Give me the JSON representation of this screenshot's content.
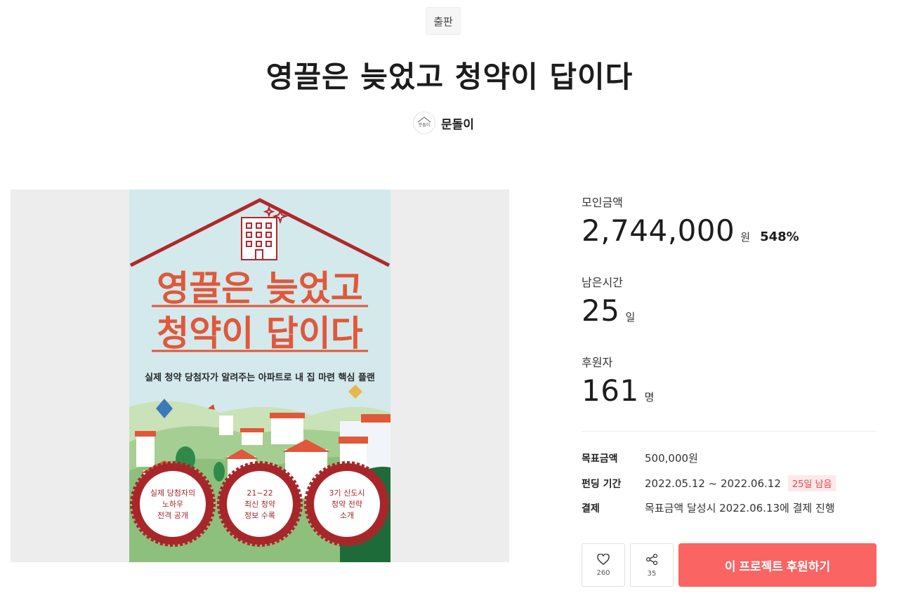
{
  "header": {
    "category": "출판",
    "title": "영끌은 늦었고 청약이 답이다",
    "creator_name": "문돌이",
    "creator_logo_text": "문돌이"
  },
  "poster": {
    "title_line1": "영끌은 늦었고",
    "title_line2": "청약이 답이다",
    "subtitle": "실제 청약 당첨자가 알려주는 아파트로 내 집 마련 핵심 플랜",
    "seals": [
      {
        "line1": "실제 당첨자의",
        "line2": "노하우",
        "line3": "전격 공개"
      },
      {
        "line1": "21~22",
        "line2": "최신 청약",
        "line3": "정보 수록"
      },
      {
        "line1": "3기 신도시",
        "line2": "청약 전략",
        "line3": "소개"
      }
    ],
    "colors": {
      "sky": "#d3e9ec",
      "title": "#e0583a",
      "roof": "#b1272b",
      "seal": "#a8262a"
    }
  },
  "stats": {
    "raised_label": "모인금액",
    "raised_value": "2,744,000",
    "raised_unit": "원",
    "raised_percent": "548%",
    "time_label": "남은시간",
    "time_value": "25",
    "time_unit": "일",
    "backers_label": "후원자",
    "backers_value": "161",
    "backers_unit": "명"
  },
  "info": {
    "goal_label": "목표금액",
    "goal_value": "500,000원",
    "period_label": "펀딩 기간",
    "period_value": "2022.05.12 ~ 2022.06.12",
    "days_left_badge": "25일 남음",
    "payment_label": "결제",
    "payment_value": "목표금액 달성시 2022.06.13에 결제 진행"
  },
  "actions": {
    "like_count": "260",
    "share_count": "35",
    "support_label": "이 프로젝트 후원하기",
    "like_icon": "heart-icon",
    "share_icon": "share-icon"
  },
  "colors": {
    "accent": "#fa6462",
    "badge_text": "#e8444f",
    "badge_bg": "#fde9ea"
  }
}
